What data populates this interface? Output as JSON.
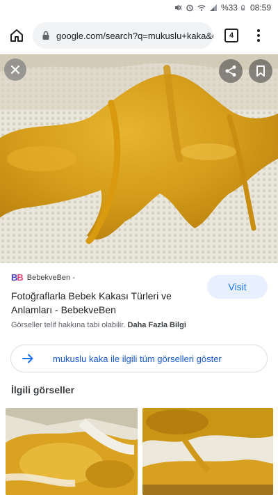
{
  "status_bar": {
    "battery_percent": "%33",
    "time": "08:59"
  },
  "browser": {
    "url": "google.com/search?q=mukuslu+kaka&oq=",
    "tab_count": "4"
  },
  "icons": {
    "home": "home-icon",
    "lock": "lock-icon",
    "menu": "more-vert-icon",
    "close": "close-icon",
    "share": "share-icon",
    "bookmark": "bookmark-icon",
    "arrow": "arrow-right-icon"
  },
  "result": {
    "source_logo_part1": "B",
    "source_logo_part2": "B",
    "source_name": "BebekveBen -",
    "title": "Fotoğraflarla Bebek Kakası Türleri ve Anlamları - BebekveBen",
    "visit_label": "Visit",
    "copyright_text": "Görseller telif hakkına tabi olabilir.",
    "more_info": "Daha Fazla Bilgi"
  },
  "related": {
    "see_all_label": "mukuslu kaka ile ilgili tüm görselleri göster",
    "section_title": "İlgili görseller"
  },
  "colors": {
    "accent": "#1a73e8",
    "visit_bg": "#e8f0fe",
    "stool_yellow": "#d9a21a"
  }
}
